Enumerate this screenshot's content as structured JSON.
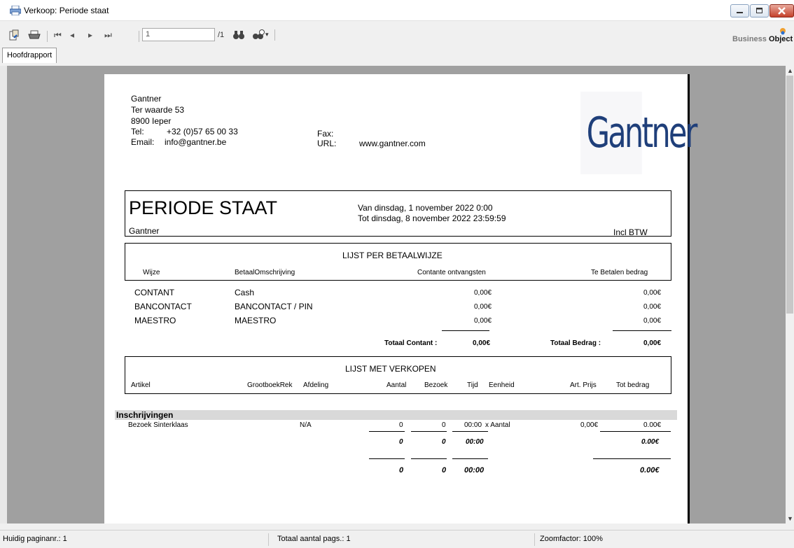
{
  "window": {
    "title": "Verkoop: Periode staat"
  },
  "toolbar": {
    "page_value": "1",
    "page_total": "/1"
  },
  "brand": {
    "prefix": "Business ",
    "name": "Object"
  },
  "tabs": [
    {
      "label": "Hoofdrapport"
    }
  ],
  "report": {
    "company": {
      "name": "Gantner",
      "street": "Ter waarde  53",
      "city": "8900 Ieper",
      "tel_label": "Tel:",
      "tel": "+32 (0)57 65 00 33",
      "email_label": "Email:",
      "email": "info@gantner.be",
      "fax_label": "Fax:",
      "url_label": "URL:",
      "url": "www.gantner.com",
      "logo_text": "Gantner"
    },
    "header": {
      "title": "PERIODE STAAT",
      "subtitle": "Gantner",
      "from": "Van dinsdag, 1 november 2022  0:00",
      "to": "Tot dinsdag, 8 november 2022  23:59:59",
      "tax_mode": "Incl BTW"
    },
    "payments": {
      "title": "LIJST PER BETAALWIJZE",
      "columns": [
        "Wijze",
        "BetaalOmschrijving",
        "Contante ontvangsten",
        "Te Betalen bedrag"
      ],
      "rows": [
        {
          "method": "CONTANT",
          "desc": "Cash",
          "cash": "0,00€",
          "due": "0,00€"
        },
        {
          "method": "BANCONTACT",
          "desc": "BANCONTACT / PIN",
          "cash": "0,00€",
          "due": "0,00€"
        },
        {
          "method": "MAESTRO",
          "desc": "MAESTRO",
          "cash": "0,00€",
          "due": "0,00€"
        }
      ],
      "total_cash_label": "Totaal Contant :",
      "total_cash": "0,00€",
      "total_due_label": "Totaal Bedrag :",
      "total_due": "0,00€"
    },
    "sales": {
      "title": "LIJST MET VERKOPEN",
      "columns": [
        "Artikel",
        "GrootboekRek",
        "Afdeling",
        "Aantal",
        "Bezoek",
        "Tijd",
        "Eenheid",
        "Art. Prijs",
        "Tot bedrag"
      ],
      "group": "Inschrijvingen",
      "row": {
        "article": "Bezoek Sinterklaas",
        "dept": "N/A",
        "qty": "0",
        "visits": "0",
        "time": "00:00",
        "unit": "x Aantal",
        "price": "0,00€",
        "total": "0.00€"
      },
      "subtotal": {
        "qty": "0",
        "visits": "0",
        "time": "00:00",
        "total": "0.00€"
      },
      "grandtotal": {
        "qty": "0",
        "visits": "0",
        "time": "00:00",
        "total": "0.00€"
      }
    }
  },
  "status": {
    "current_page": "Huidig paginanr.: 1",
    "total_pages": "Totaal aantal pags.: 1",
    "zoom": "Zoomfactor: 100%"
  },
  "colors": {
    "logo": "#1f3f7a",
    "group_band": "#d9d9d9",
    "viewer_bg": "#a0a0a0"
  }
}
